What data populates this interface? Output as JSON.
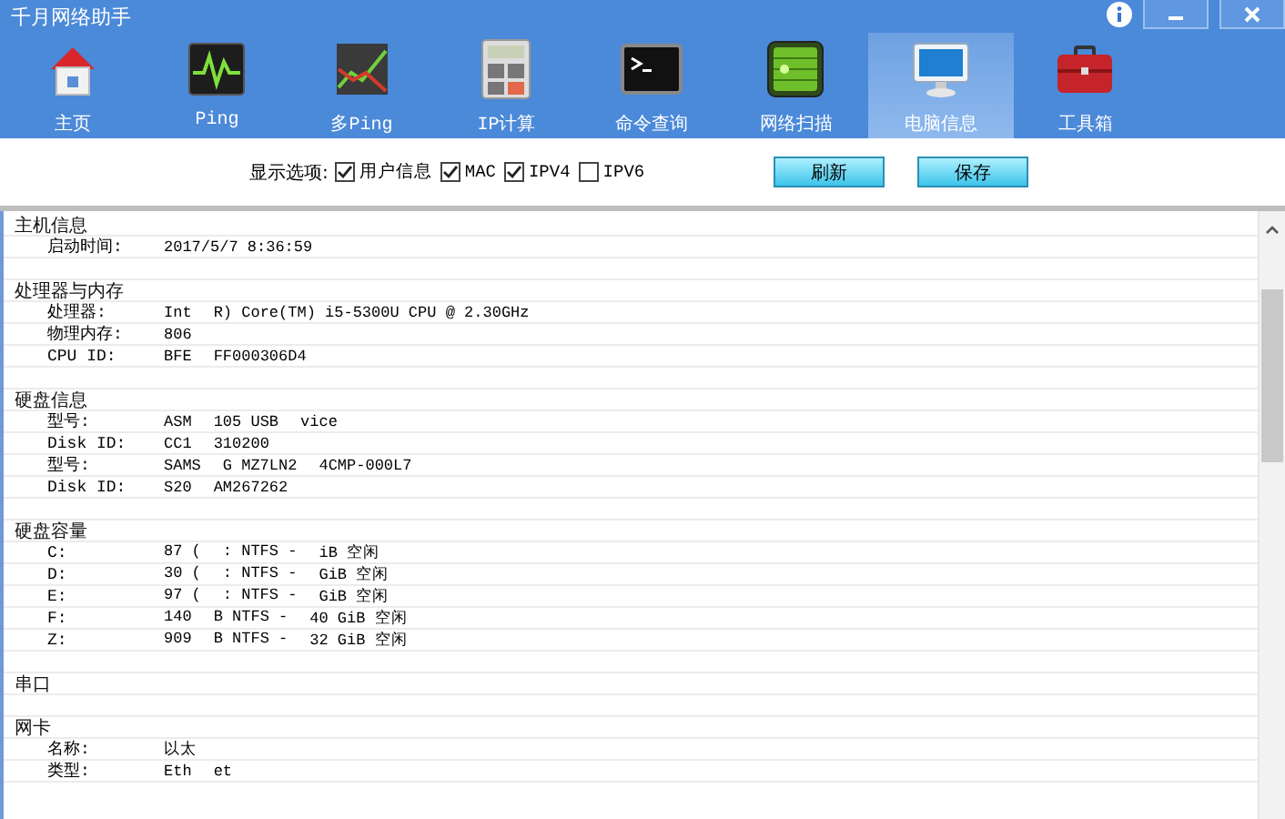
{
  "window": {
    "title": "千月网络助手"
  },
  "tabs": [
    {
      "label": "主页",
      "selected": false
    },
    {
      "label": "Ping",
      "selected": false
    },
    {
      "label": "多Ping",
      "selected": false
    },
    {
      "label": "IP计算",
      "selected": false
    },
    {
      "label": "命令查询",
      "selected": false
    },
    {
      "label": "网络扫描",
      "selected": false
    },
    {
      "label": "电脑信息",
      "selected": true
    },
    {
      "label": "工具箱",
      "selected": false
    }
  ],
  "options": {
    "label": "显示选项:",
    "checkboxes": [
      {
        "label": "用户信息",
        "checked": true
      },
      {
        "label": "MAC",
        "checked": true
      },
      {
        "label": "IPV4",
        "checked": true
      },
      {
        "label": "IPV6",
        "checked": false
      }
    ],
    "buttons": [
      "刷新",
      "保存"
    ]
  },
  "rows": [
    {
      "kind": "section",
      "label": "主机信息"
    },
    {
      "kind": "field",
      "label": "启动时间:",
      "value": [
        "2017/5/7 8:36:59"
      ]
    },
    {
      "kind": "blank"
    },
    {
      "kind": "section",
      "label": "处理器与内存"
    },
    {
      "kind": "field",
      "label": "处理器:",
      "value": [
        "Int",
        "R) Core(TM) i5-5300U CPU @ 2.30GHz"
      ]
    },
    {
      "kind": "field",
      "label": "物理内存:",
      "value": [
        "806"
      ]
    },
    {
      "kind": "field",
      "label": "CPU ID:",
      "value": [
        "BFE",
        "FF000306D4"
      ]
    },
    {
      "kind": "blank"
    },
    {
      "kind": "section",
      "label": "硬盘信息"
    },
    {
      "kind": "field",
      "label": "型号:",
      "value": [
        "ASM",
        "105 USB",
        "vice"
      ]
    },
    {
      "kind": "field",
      "label": "Disk ID:",
      "value": [
        "CC1",
        "310200"
      ]
    },
    {
      "kind": "field",
      "label": "型号:",
      "value": [
        "SAMS",
        "G MZ7LN2",
        "4CMP-000L7"
      ]
    },
    {
      "kind": "field",
      "label": "Disk ID:",
      "value": [
        "S20",
        "AM267262"
      ]
    },
    {
      "kind": "blank"
    },
    {
      "kind": "section",
      "label": "硬盘容量"
    },
    {
      "kind": "field",
      "label": "C:",
      "value": [
        "87 (",
        ": NTFS -",
        "iB 空闲"
      ]
    },
    {
      "kind": "field",
      "label": "D:",
      "value": [
        "30 (",
        ": NTFS -",
        "GiB 空闲"
      ]
    },
    {
      "kind": "field",
      "label": "E:",
      "value": [
        "97 (",
        ": NTFS -",
        "GiB 空闲"
      ]
    },
    {
      "kind": "field",
      "label": "F:",
      "value": [
        "140",
        "B NTFS -",
        "40 GiB 空闲"
      ]
    },
    {
      "kind": "field",
      "label": "Z:",
      "value": [
        "909",
        "B NTFS -",
        "32 GiB 空闲"
      ]
    },
    {
      "kind": "blank"
    },
    {
      "kind": "section",
      "label": "串口"
    },
    {
      "kind": "blank"
    },
    {
      "kind": "section",
      "label": "网卡"
    },
    {
      "kind": "field",
      "label": "名称:",
      "value": [
        "以太"
      ]
    },
    {
      "kind": "field",
      "label": "类型:",
      "value": [
        "Eth",
        "et"
      ]
    }
  ]
}
